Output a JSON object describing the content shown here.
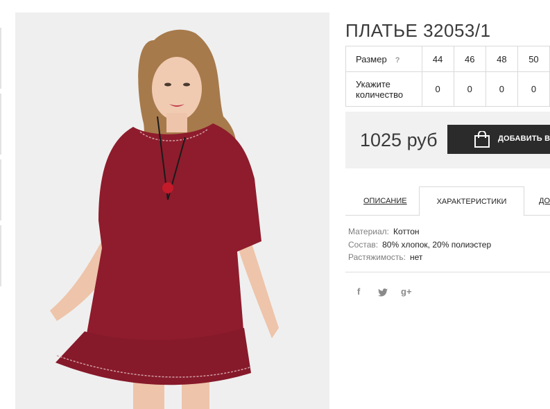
{
  "product": {
    "title": "ПЛАТЬЕ 32053/1",
    "image_alt": "Платье 32053/1"
  },
  "size_table": {
    "size_label": "Размер",
    "help": "?",
    "quantity_label": "Укажите количество",
    "sizes": [
      "44",
      "46",
      "48",
      "50"
    ],
    "quantities": [
      "0",
      "0",
      "0",
      "0"
    ]
  },
  "purchase": {
    "price": "1025 руб",
    "add_to_cart": "ДОБАВИТЬ В К"
  },
  "tabs": [
    {
      "label": "ОПИСАНИЕ"
    },
    {
      "label": "ХАРАКТЕРИСТИКИ"
    },
    {
      "label": "ДО"
    }
  ],
  "specs": [
    {
      "key": "Материал:",
      "value": "Коттон"
    },
    {
      "key": "Состав:",
      "value": "80% хлопок, 20% полиэстер"
    },
    {
      "key": "Растяжимость:",
      "value": "нет"
    }
  ],
  "social": {
    "facebook": "f",
    "twitter": "twitter-icon",
    "googleplus": "g+"
  },
  "colors": {
    "dress": "#8e1c2c",
    "button": "#2b2b2b",
    "price_bg": "#f1f1f1"
  }
}
